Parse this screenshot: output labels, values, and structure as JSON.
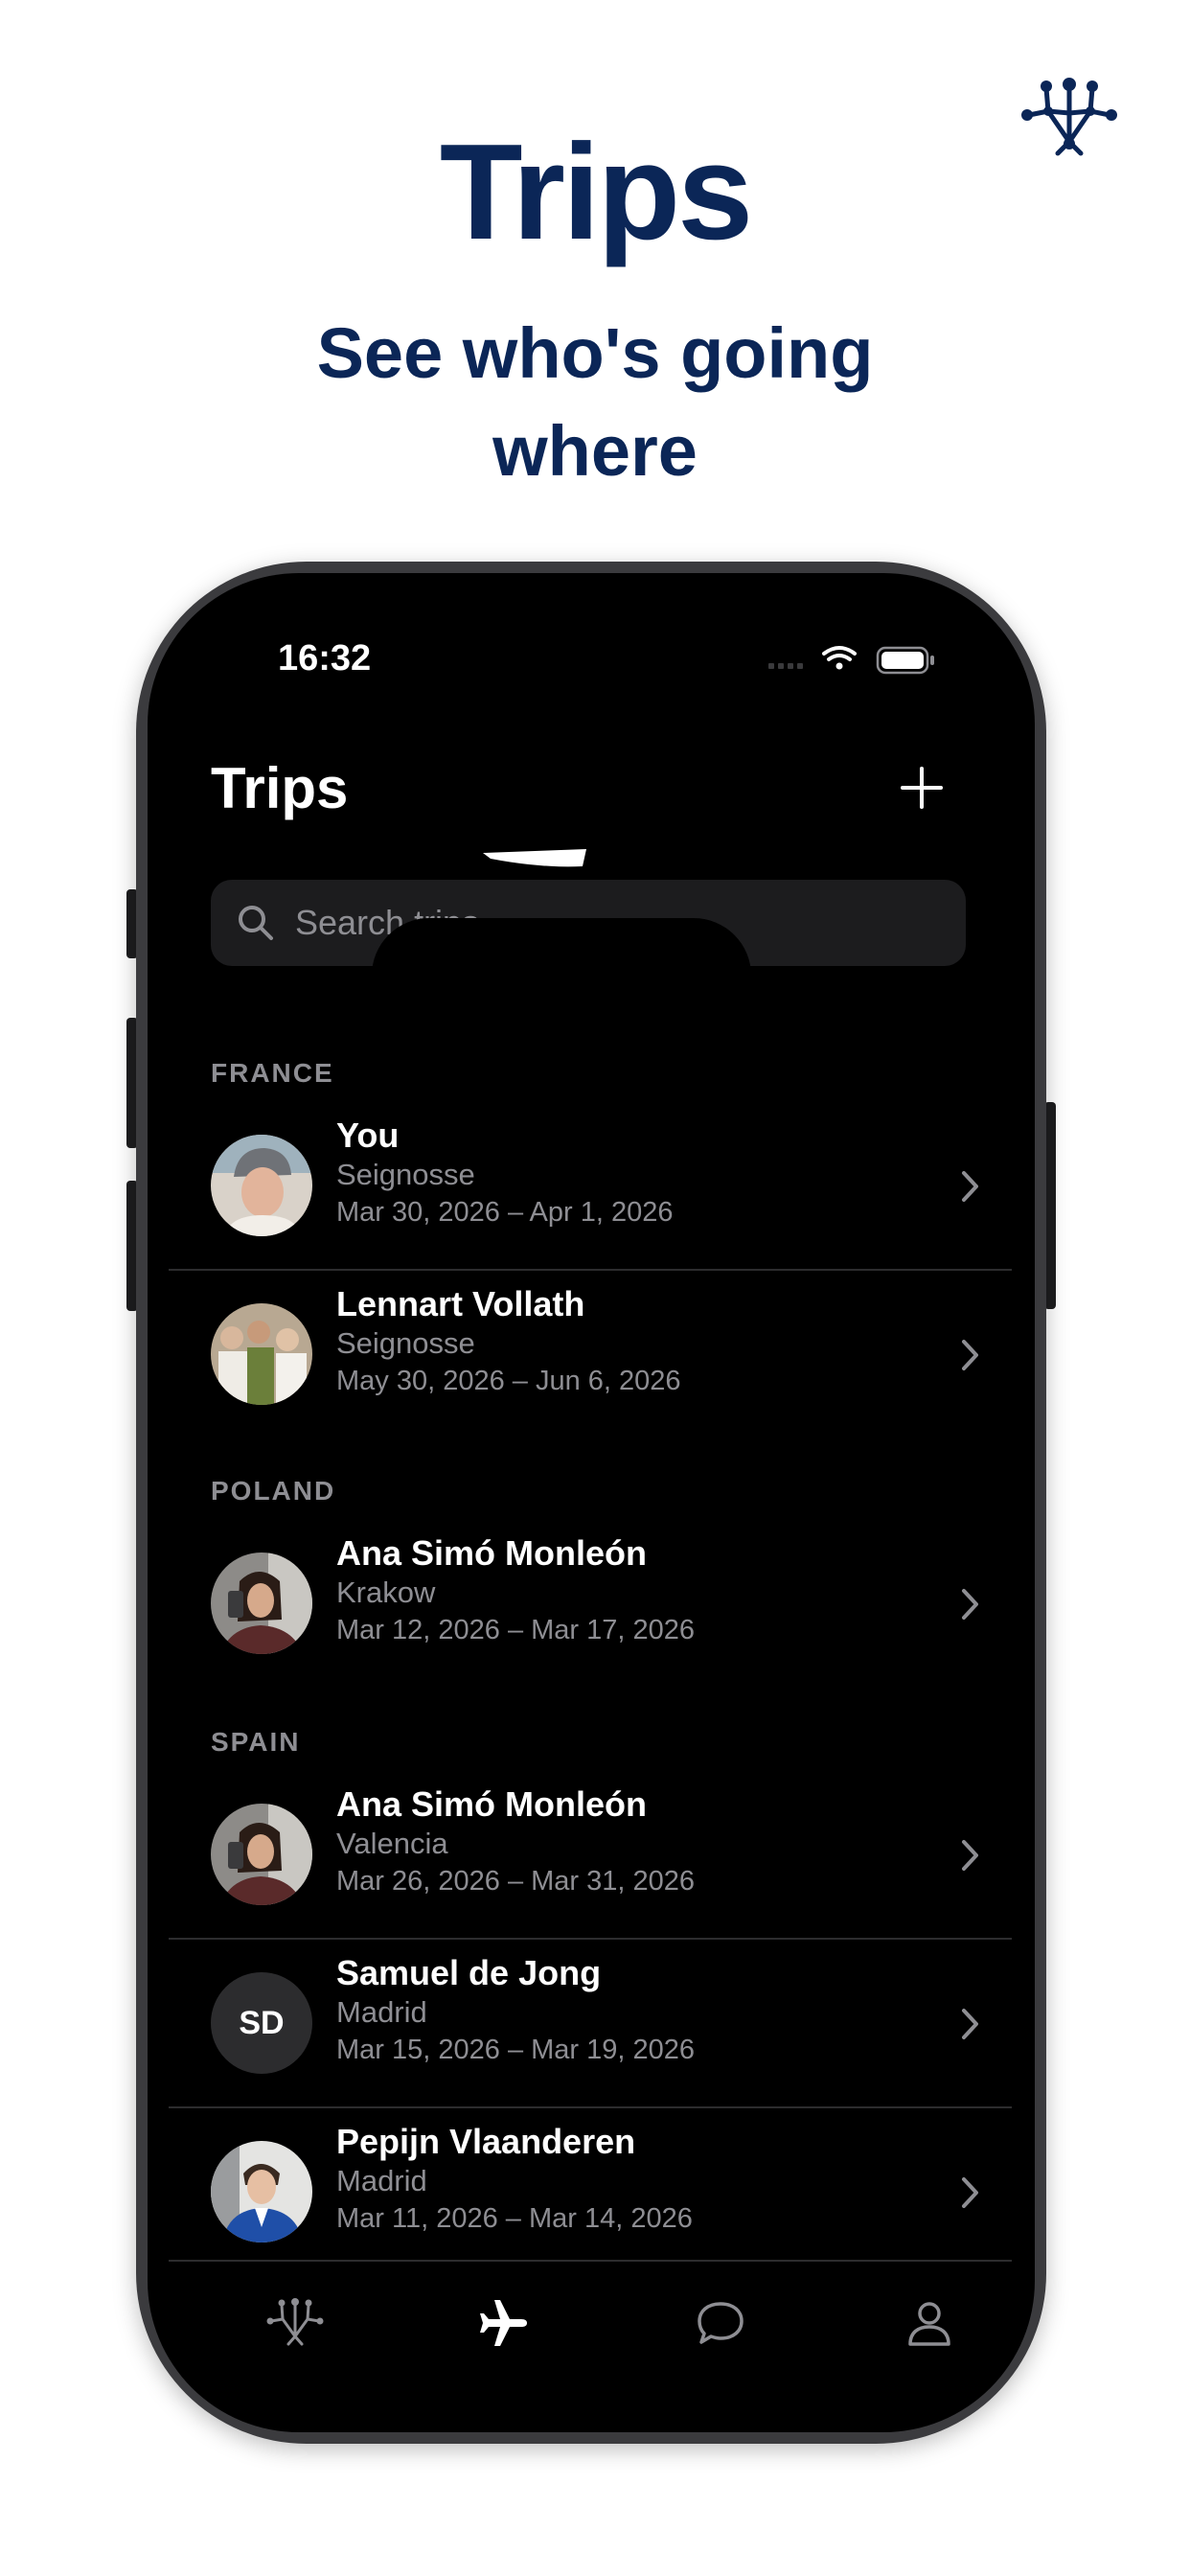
{
  "promo": {
    "title": "Trips",
    "subtitle_line1": "See who's going",
    "subtitle_line2": "where"
  },
  "status_bar": {
    "time": "16:32"
  },
  "header": {
    "title": "Trips"
  },
  "search": {
    "placeholder": "Search trips"
  },
  "sections": [
    {
      "label": "FRANCE",
      "trips": [
        {
          "name": "You",
          "place": "Seignosse",
          "dates": "Mar 30, 2026 – Apr 1, 2026"
        },
        {
          "name": "Lennart Vollath",
          "place": "Seignosse",
          "dates": "May 30, 2026 – Jun 6, 2026"
        }
      ]
    },
    {
      "label": "POLAND",
      "trips": [
        {
          "name": "Ana Simó Monleón",
          "place": "Krakow",
          "dates": "Mar 12, 2026 – Mar 17, 2026"
        }
      ]
    },
    {
      "label": "SPAIN",
      "trips": [
        {
          "name": "Ana Simó Monleón",
          "place": "Valencia",
          "dates": "Mar 26, 2026 – Mar 31, 2026"
        },
        {
          "name": "Samuel de Jong",
          "place": "Madrid",
          "dates": "Mar 15, 2026 – Mar 19, 2026",
          "initials": "SD"
        },
        {
          "name": "Pepijn Vlaanderen",
          "place": "Madrid",
          "dates": "Mar 11, 2026 – Mar 14, 2026"
        }
      ]
    }
  ],
  "tabs": [
    {
      "icon": "network-icon",
      "active": false
    },
    {
      "icon": "airplane-icon",
      "active": true
    },
    {
      "icon": "chat-bubble-icon",
      "active": false
    },
    {
      "icon": "person-icon",
      "active": false
    }
  ],
  "colors": {
    "brand_navy": "#0b2657",
    "screen_bg": "#000000",
    "secondary_text": "#8e8e93",
    "search_bg": "#1c1c1e"
  }
}
